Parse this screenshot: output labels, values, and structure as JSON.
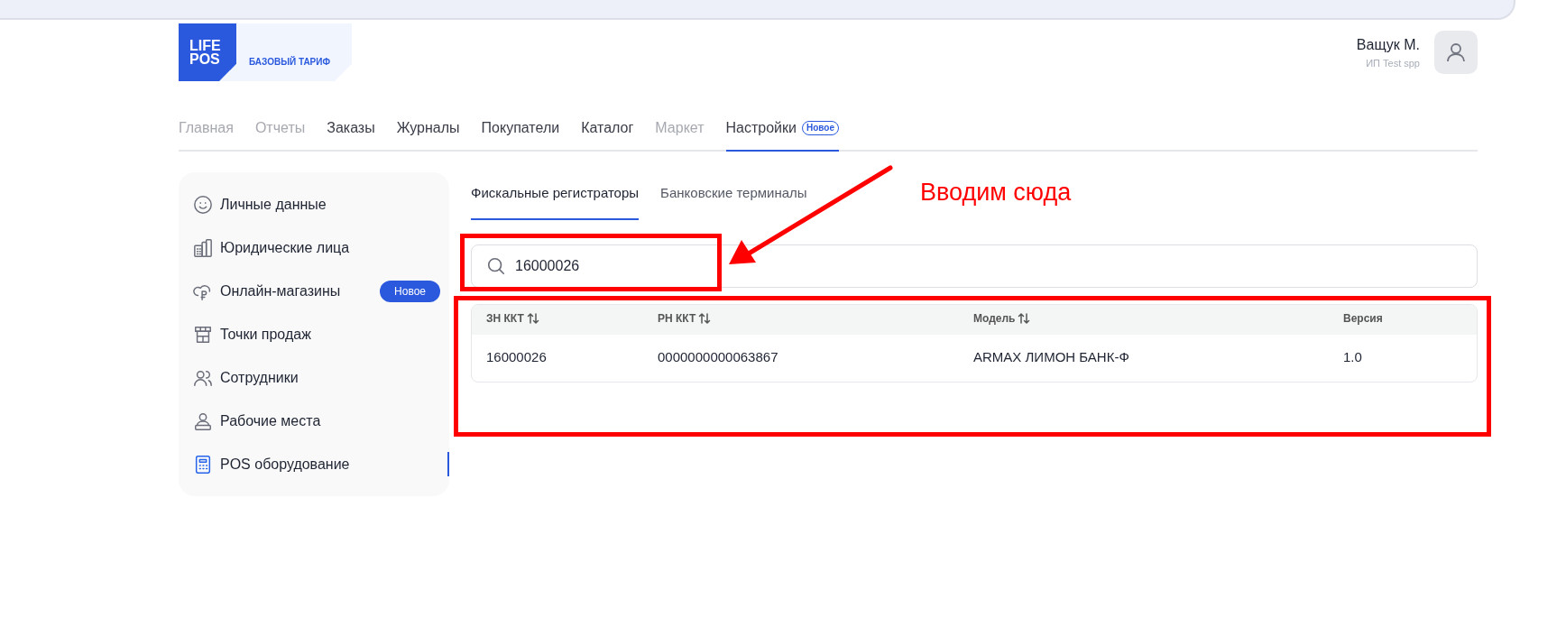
{
  "brand": {
    "logo_lines": [
      "LIFE",
      "POS"
    ],
    "plan": "БАЗОВЫЙ ТАРИФ"
  },
  "user": {
    "name": "Ващук М.",
    "org": "ИП Test spp"
  },
  "nav": [
    {
      "label": "Главная",
      "selected": false,
      "disabled": true
    },
    {
      "label": "Отчеты",
      "selected": false,
      "disabled": true
    },
    {
      "label": "Заказы",
      "selected": false,
      "disabled": false
    },
    {
      "label": "Журналы",
      "selected": false,
      "disabled": false
    },
    {
      "label": "Покупатели",
      "selected": false,
      "disabled": false
    },
    {
      "label": "Каталог",
      "selected": false,
      "disabled": false
    },
    {
      "label": "Маркет",
      "selected": false,
      "disabled": true
    },
    {
      "label": "Настройки",
      "selected": true,
      "disabled": false,
      "badge": "Новое"
    }
  ],
  "sidebar": {
    "items": [
      {
        "label": "Личные данные",
        "selected": false
      },
      {
        "label": "Юридические лица",
        "selected": false
      },
      {
        "label": "Онлайн-магазины",
        "selected": false,
        "badge": "Новое"
      },
      {
        "label": "Точки продаж",
        "selected": false
      },
      {
        "label": "Сотрудники",
        "selected": false
      },
      {
        "label": "Рабочие места",
        "selected": false
      },
      {
        "label": "POS оборудование",
        "selected": true
      }
    ]
  },
  "tabs": [
    {
      "label": "Фискальные регистраторы",
      "selected": true
    },
    {
      "label": "Банковские терминалы",
      "selected": false
    }
  ],
  "search": {
    "value": "16000026"
  },
  "table": {
    "columns": [
      {
        "label": "ЗН ККТ",
        "sortable": true
      },
      {
        "label": "РН ККТ",
        "sortable": true
      },
      {
        "label": "Модель",
        "sortable": true
      },
      {
        "label": "Версия",
        "sortable": false
      }
    ],
    "rows": [
      [
        "16000026",
        "0000000000063867",
        "ARMAX ЛИМОН БАНК-Ф",
        "1.0"
      ]
    ]
  },
  "annotation": {
    "text": "Вводим сюда"
  }
}
